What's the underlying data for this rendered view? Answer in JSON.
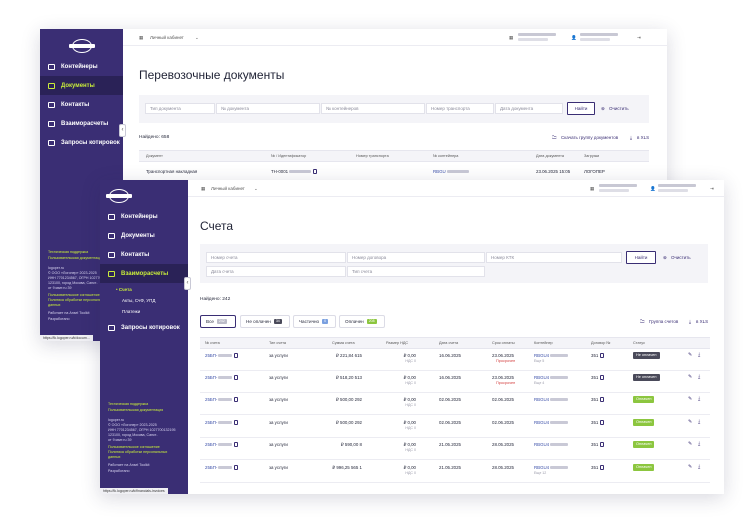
{
  "app": {
    "cabinet": "Личный кабинет",
    "exit_icon": "exit-icon"
  },
  "back_window": {
    "sidebar": {
      "items": [
        {
          "label": "Контейнеры",
          "icon": "container-icon"
        },
        {
          "label": "Документы",
          "icon": "documents-icon",
          "active": true
        },
        {
          "label": "Контакты",
          "icon": "contacts-icon"
        },
        {
          "label": "Взаиморасчеты",
          "icon": "settlements-icon"
        },
        {
          "label": "Запросы котировок",
          "icon": "quotes-icon"
        }
      ],
      "footer": [
        "Техническая поддержка",
        "Пользовательская документация",
        "logoper.ru",
        "© ООО «Логопер» 2023-2025",
        "ИНН 7701234567, ОГРН 1027700132195",
        "123100, город Москва, Санкт-",
        "от 9 квит.ru 39",
        "Пользовательское соглашение",
        "Политика обработки персональных",
        "данных",
        "Работает на Ansel Toolkit",
        "Разработано"
      ],
      "url": "https://lk.logoper.ru/k/docum..."
    },
    "title": "Перевозочные документы",
    "filters": {
      "doc_type": "Тип документа",
      "doc_number": "№ документа",
      "container_number": "№ контейнеров",
      "transport_number": "Номер транспорта",
      "doc_date": "Дата документа",
      "find": "Найти",
      "clear": "Очистить"
    },
    "found": "Найдено: 658",
    "download_group": "Скачать группу документов",
    "xls": "в XLS",
    "columns": [
      "Документ",
      "№ / Идентификатор",
      "Номер транспорта",
      "№ контейнера",
      "Дата документа",
      "Загрузки"
    ],
    "row": {
      "doc": "Транспортная накладная",
      "id": "TH-0001",
      "container": "RBGU",
      "date": "23.06.2025 15:05",
      "load": "ЛОГОПЕР"
    }
  },
  "front_window": {
    "sidebar": {
      "items": [
        {
          "label": "Контейнеры",
          "icon": "container-icon"
        },
        {
          "label": "Документы",
          "icon": "documents-icon"
        },
        {
          "label": "Контакты",
          "icon": "contacts-icon"
        },
        {
          "label": "Взаиморасчеты",
          "icon": "settlements-icon",
          "active": true
        }
      ],
      "subitems": [
        "Счета",
        "Акты, СчФ, УПД",
        "Платежи"
      ],
      "quotes": "Запросы котировок",
      "footer": [
        "Техническая поддержка",
        "Пользовательская документация",
        "logoper.ru",
        "© ООО «Логопер» 2023-2025",
        "ИНН 7701234567, ОГРН 1027700132195",
        "123100, город Москва, Санкт-",
        "от 9 квит.ru 39",
        "Пользовательское соглашение",
        "Политика обработки персональных",
        "данных",
        "Работает на Ansel Toolkit",
        "Разработано"
      ],
      "url": "https://lk.logoper.ru/k/financials-invoices"
    },
    "title": "Счета",
    "filters": {
      "invoice_number": "Номер счета",
      "contract_number": "Номер договора",
      "ktk_number": "Номер КТК",
      "invoice_date": "Дата счета",
      "invoice_type": "Тип счета",
      "find": "Найти",
      "clear": "Очистить"
    },
    "found": "Найдено: 242",
    "tabs": [
      {
        "label": "Все",
        "count": "242",
        "color": "#bcbcc8",
        "active": true
      },
      {
        "label": "Не оплачен",
        "count": "34",
        "color": "#4a4a5a"
      },
      {
        "label": "Частично",
        "count": "0",
        "color": "#7aa0e0"
      },
      {
        "label": "Оплачен",
        "count": "208",
        "color": "#8cc63f"
      }
    ],
    "group_invoices": "Группа счетов",
    "xls": "в XLS",
    "columns": [
      "№ счета",
      "Тип счета",
      "Сумма счета",
      "Размер НДС",
      "Дата счета",
      "Срок оплаты",
      "Контейнер",
      "Договор №",
      "Статус"
    ],
    "rows": [
      {
        "num": "25БП-",
        "type": "за услуги",
        "sum": "615 221,84 ₽",
        "vat": "0,00 ₽",
        "vat_note": "НДС 0",
        "date": "16.06.2025",
        "due": "23.06.2025",
        "overdue": "Просрочен",
        "container": "RBGU4",
        "more": "Еще 5",
        "contract": "351",
        "status": "Не оплачен",
        "status_kind": "dark"
      },
      {
        "num": "25БП-",
        "type": "за услуги",
        "sum": "513 518,20 ₽",
        "vat": "0,00 ₽",
        "vat_note": "НДС 0",
        "date": "16.06.2025",
        "due": "23.06.2025",
        "overdue": "Просрочен",
        "container": "RBGU4",
        "more": "Еще 4",
        "contract": "351",
        "status": "Не оплачен",
        "status_kind": "dark"
      },
      {
        "num": "25БП-",
        "type": "за услуги",
        "sum": "292 500,00 ₽",
        "vat": "0,00 ₽",
        "vat_note": "НДС 0",
        "date": "02.06.2025",
        "due": "02.06.2025",
        "overdue": "",
        "container": "RBGU4",
        "more": "",
        "contract": "351",
        "status": "Оплачен",
        "status_kind": "green"
      },
      {
        "num": "25БП-",
        "type": "за услуги",
        "sum": "292 500,00 ₽",
        "vat": "0,00 ₽",
        "vat_note": "НДС 0",
        "date": "02.06.2025",
        "due": "02.06.2025",
        "overdue": "",
        "container": "RBGU4",
        "more": "",
        "contract": "351",
        "status": "Оплачен",
        "status_kind": "green"
      },
      {
        "num": "25БП-",
        "type": "за услуги",
        "sum": "8 590,00 ₽",
        "vat": "0,00 ₽",
        "vat_note": "НДС 0",
        "date": "21.05.2025",
        "due": "28.05.2025",
        "overdue": "",
        "container": "RBGU4",
        "more": "",
        "contract": "351",
        "status": "Оплачен",
        "status_kind": "green"
      },
      {
        "num": "25БП-",
        "type": "за услуги",
        "sum": "1 565 996,25 ₽",
        "vat": "0,00 ₽",
        "vat_note": "НДС 0",
        "date": "21.05.2025",
        "due": "28.05.2025",
        "overdue": "",
        "container": "RBGU4",
        "more": "Еще 12",
        "contract": "351",
        "status": "Оплачен",
        "status_kind": "green"
      }
    ]
  }
}
